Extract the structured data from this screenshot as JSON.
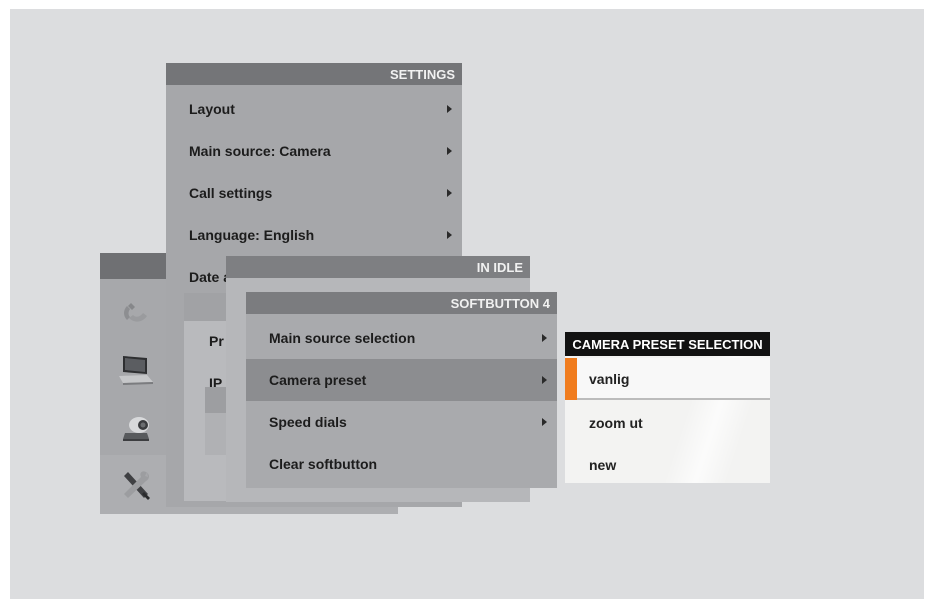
{
  "settings_menu": {
    "title": "SETTINGS",
    "items": [
      {
        "label": "Layout",
        "has_submenu": true
      },
      {
        "label": "Main source: Camera",
        "has_submenu": true
      },
      {
        "label": "Call settings",
        "has_submenu": true
      },
      {
        "label": "Language: English",
        "has_submenu": true
      },
      {
        "label": "Date a",
        "has_submenu": false
      }
    ]
  },
  "background_panel": {
    "labels": [
      "Pr",
      "IP"
    ]
  },
  "sidebar": {
    "icons": [
      "phone-icon",
      "laptop-icon",
      "camera-icon",
      "tools-icon"
    ]
  },
  "idle_panel": {
    "title": "IN IDLE"
  },
  "softbutton_menu": {
    "title": "SOFTBUTTON 4",
    "items": [
      {
        "label": "Main source selection",
        "has_submenu": true
      },
      {
        "label": "Camera preset",
        "has_submenu": true,
        "selected": true
      },
      {
        "label": "Speed dials",
        "has_submenu": true
      },
      {
        "label": "Clear softbutton",
        "has_submenu": false
      }
    ]
  },
  "camera_preset_menu": {
    "title": "CAMERA PRESET SELECTION",
    "items": [
      {
        "label": "vanlig",
        "selected": true
      },
      {
        "label": "zoom ut"
      },
      {
        "label": "new"
      }
    ]
  },
  "colors": {
    "selection_accent": "#f07c1e",
    "stage_background": "#dcdddf"
  }
}
